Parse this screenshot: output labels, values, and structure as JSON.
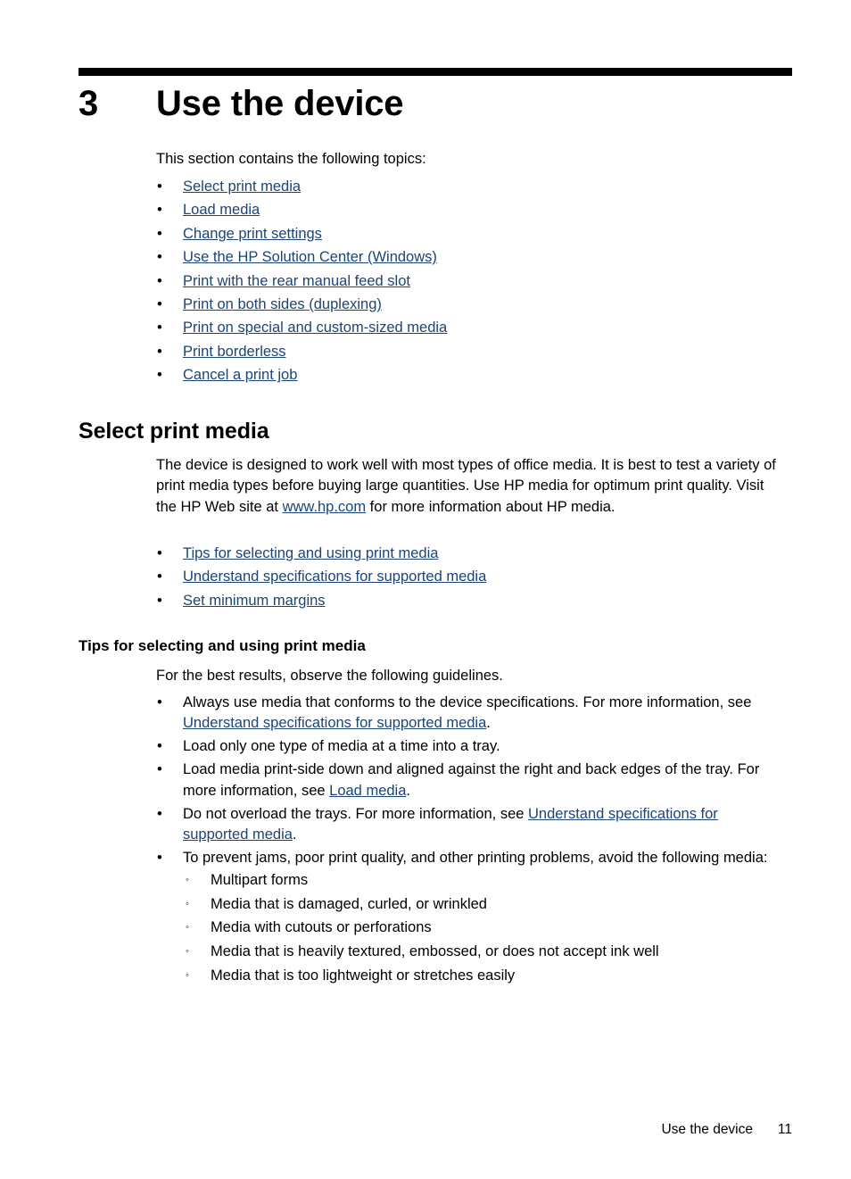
{
  "colors": {
    "link": "#1c4477",
    "text": "#000000",
    "rule": "#000000",
    "page_background": "#ffffff"
  },
  "chapter": {
    "number": "3",
    "title": "Use the device",
    "intro": "This section contains the following topics:"
  },
  "toc": {
    "bullet": "•",
    "items": [
      {
        "label": "Select print media"
      },
      {
        "label": "Load media"
      },
      {
        "label": "Change print settings"
      },
      {
        "label": "Use the HP Solution Center (Windows)"
      },
      {
        "label": "Print with the rear manual feed slot"
      },
      {
        "label": "Print on both sides (duplexing)"
      },
      {
        "label": "Print on special and custom-sized media"
      },
      {
        "label": "Print borderless"
      },
      {
        "label": "Cancel a print job"
      }
    ]
  },
  "section": {
    "heading": "Select print media",
    "paragraph": {
      "part1": "The device is designed to work well with most types of office media. It is best to test a variety of print media types before buying large quantities. Use HP media for optimum print quality. Visit the HP Web site at ",
      "link": "www.hp.com",
      "part2": " for more information about HP media."
    },
    "sublinks": [
      {
        "label": "Tips for selecting and using print media"
      },
      {
        "label": "Understand specifications for supported media"
      },
      {
        "label": "Set minimum margins"
      }
    ]
  },
  "subsection": {
    "heading": "Tips for selecting and using print media",
    "intro": "For the best results, observe the following guidelines.",
    "bullet": "•",
    "sub_bullet": "◦",
    "guidelines": [
      {
        "part1": "Always use media that conforms to the device specifications. For more information, see ",
        "link": "Understand specifications for supported media",
        "part2": "."
      },
      {
        "part1": "Load only one type of media at a time into a tray.",
        "link": "",
        "part2": ""
      },
      {
        "part1": "Load media print-side down and aligned against the right and back edges of the tray. For more information, see ",
        "link": "Load media",
        "part2": "."
      },
      {
        "part1": "Do not overload the trays. For more information, see ",
        "link": "Understand specifications for supported media",
        "part2": "."
      },
      {
        "part1": "To prevent jams, poor print quality, and other printing problems, avoid the following media:",
        "link": "",
        "part2": ""
      }
    ],
    "avoid_media": [
      {
        "label": "Multipart forms"
      },
      {
        "label": "Media that is damaged, curled, or wrinkled"
      },
      {
        "label": "Media with cutouts or perforations"
      },
      {
        "label": "Media that is heavily textured, embossed, or does not accept ink well"
      },
      {
        "label": "Media that is too lightweight or stretches easily"
      }
    ]
  },
  "footer": {
    "chapter_label": "Use the device",
    "page_number": "11"
  }
}
